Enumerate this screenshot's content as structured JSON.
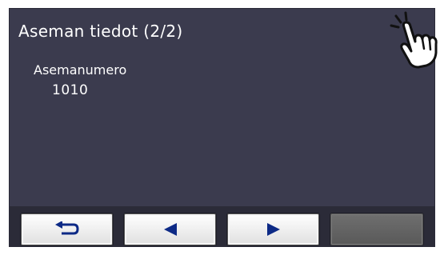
{
  "screen": {
    "title": "Aseman tiedot (2/2)"
  },
  "fields": [
    {
      "label": "Asemanumero",
      "value": "1010"
    }
  ],
  "footer": {
    "buttons": [
      {
        "icon": "return-arrow-icon",
        "enabled": true
      },
      {
        "icon": "triangle-left-icon",
        "enabled": true
      },
      {
        "icon": "triangle-right-icon",
        "enabled": true
      },
      {
        "icon": "",
        "enabled": false
      }
    ]
  },
  "overlay": {
    "icon": "touch-hand-icon"
  },
  "colors": {
    "screen_bg": "#3b3b4e",
    "footer_bg": "#2b2b38",
    "text": "#ffffff",
    "button_face": "#f0f0f0",
    "button_disabled": "#646464"
  }
}
